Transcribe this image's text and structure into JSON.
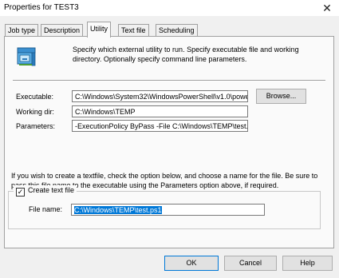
{
  "window": {
    "title": "Properties for TEST3"
  },
  "tabs": [
    {
      "label": "Job type"
    },
    {
      "label": "Description"
    },
    {
      "label": "Utility"
    },
    {
      "label": "Text file"
    },
    {
      "label": "Scheduling"
    }
  ],
  "active_tab": "Utility",
  "description": "Specify which external utility to run. Specify executable file and working directory. Optionally specify command line parameters.",
  "executable": {
    "label": "Executable:",
    "value": "C:\\Windows\\System32\\WindowsPowerShell\\v1.0\\powe"
  },
  "browse_label": "Browse...",
  "working_dir": {
    "label": "Working dir:",
    "value": "C:\\Windows\\TEMP"
  },
  "parameters": {
    "label": "Parameters:",
    "value": "-ExecutionPolicy ByPass -File C:\\Windows\\TEMP\\test.p"
  },
  "info_text": "If you wish to create a textfile, check the option below, and choose a name for the file. Be sure to pass this file name to the executable using the Parameters option above, if required.",
  "create_text_file": {
    "label": "Create text file",
    "checked": true
  },
  "file_name": {
    "label": "File name:",
    "value": "C:\\Windows\\TEMP\\test.ps1"
  },
  "buttons": {
    "ok": "OK",
    "cancel": "Cancel",
    "help": "Help"
  },
  "icons": {
    "close": "close-icon",
    "utility": "computer-utility-icon",
    "checkmark": "check-icon"
  },
  "colors": {
    "selection": "#0078d7",
    "default_button_border": "#0078d7"
  }
}
